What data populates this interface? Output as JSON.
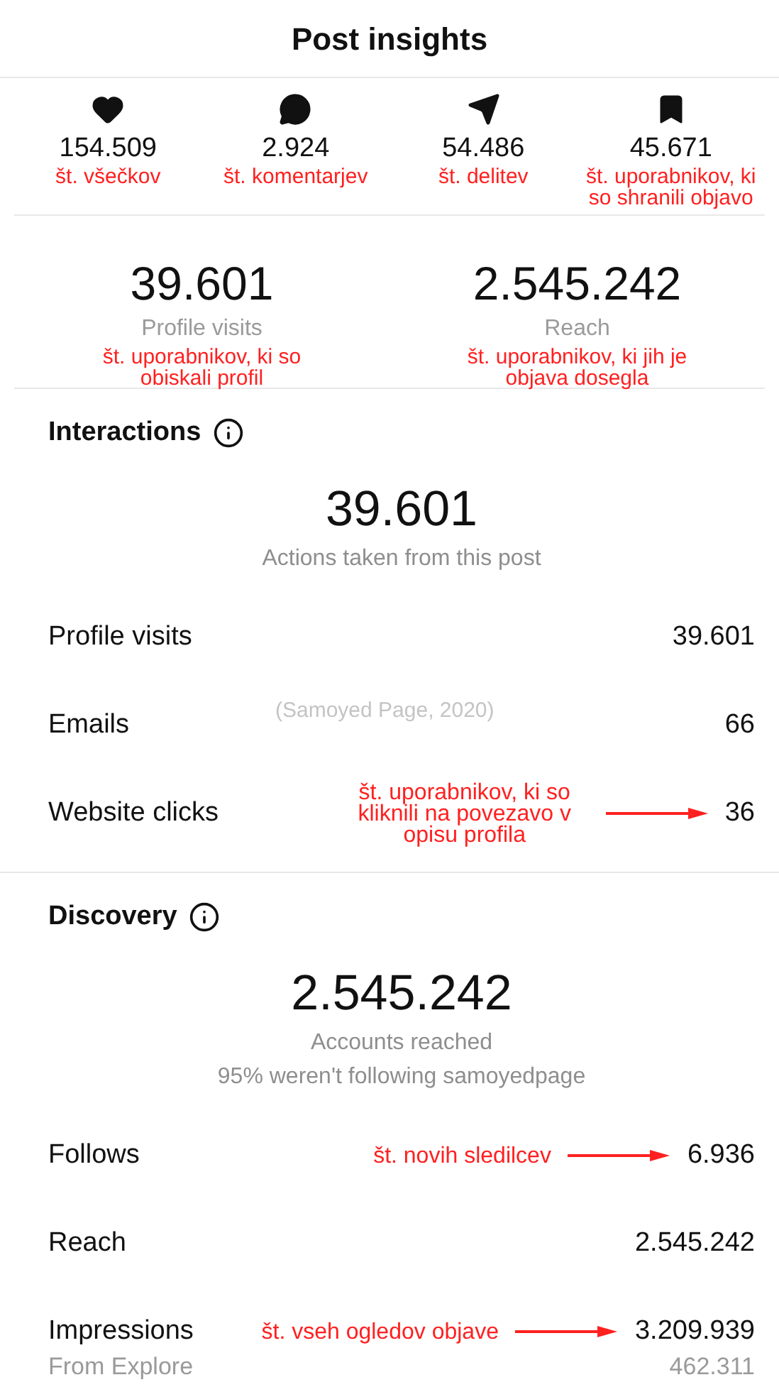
{
  "title": "Post insights",
  "top_stats": [
    {
      "kind": "heart",
      "value": "154.509",
      "note": "št. všečkov"
    },
    {
      "kind": "comment",
      "value": "2.924",
      "note": "št. komentarjev"
    },
    {
      "kind": "send",
      "value": "54.486",
      "note": "št. delitev"
    },
    {
      "kind": "bookmark",
      "value": "45.671",
      "note": "št. uporabnikov, ki so shranili objavo"
    }
  ],
  "summary": [
    {
      "value": "39.601",
      "label": "Profile visits",
      "note": "št. uporabnikov, ki so obiskali profil"
    },
    {
      "value": "2.545.242",
      "label": "Reach",
      "note": "št. uporabnikov, ki jih je objava dosegla"
    }
  ],
  "sections": [
    {
      "title": "Interactions",
      "total": "39.601",
      "caption": "Actions taken from this post",
      "rows": [
        {
          "kind": "main",
          "label": "Profile visits",
          "value": "39.601"
        },
        {
          "kind": "main",
          "label": "Emails",
          "value": "66",
          "source": "(Samoyed Page, 2020)"
        },
        {
          "kind": "main",
          "label": "Website clicks",
          "value": "36",
          "note": "št. uporabnikov, ki so kliknili na povezavo v opisu profila"
        }
      ]
    },
    {
      "title": "Discovery",
      "total": "2.545.242",
      "caption": "Accounts reached",
      "subcaption": "95% weren't following samoyedpage",
      "rows": [
        {
          "kind": "main",
          "label": "Follows",
          "value": "6.936",
          "note": "št. novih sledilcev"
        },
        {
          "kind": "main",
          "label": "Reach",
          "value": "2.545.242"
        },
        {
          "kind": "main",
          "label": "Impressions",
          "value": "3.209.939",
          "note": "št. vseh ogledov objave"
        },
        {
          "kind": "sub",
          "label": "From Explore",
          "value": "462.311"
        }
      ]
    }
  ]
}
